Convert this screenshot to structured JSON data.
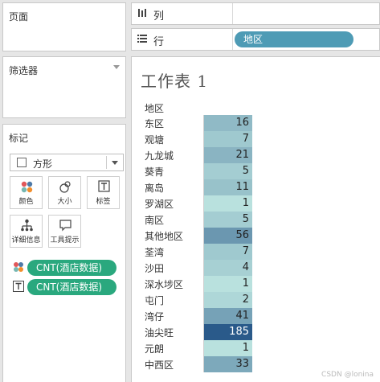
{
  "pages": {
    "title": "页面"
  },
  "filters": {
    "title": "筛选器"
  },
  "marks": {
    "title": "标记",
    "mark_type": "方形",
    "buttons": {
      "color": "颜色",
      "size": "大小",
      "label": "标签",
      "detail": "详细信息",
      "tooltip": "工具提示"
    },
    "pills": [
      {
        "text": "CNT(酒店数据)",
        "icon": "color-dots-icon"
      },
      {
        "text": "CNT(酒店数据)",
        "icon": "text-label-icon"
      }
    ],
    "pill_color": "#2aa87e"
  },
  "shelves": {
    "columns": {
      "label": "列",
      "icon": "columns-icon"
    },
    "rows": {
      "label": "行",
      "icon": "rows-icon",
      "pill": "地区"
    },
    "row_pill_color": "#4e9bb5"
  },
  "sheet": {
    "title": "工作表 1",
    "column_header": "地区",
    "rows": [
      {
        "name": "东区",
        "value": 16
      },
      {
        "name": "观塘",
        "value": 7
      },
      {
        "name": "九龙城",
        "value": 21
      },
      {
        "name": "葵青",
        "value": 5
      },
      {
        "name": "离岛",
        "value": 11
      },
      {
        "name": "罗湖区",
        "value": 1
      },
      {
        "name": "南区",
        "value": 5
      },
      {
        "name": "其他地区",
        "value": 56
      },
      {
        "name": "荃湾",
        "value": 7
      },
      {
        "name": "沙田",
        "value": 4
      },
      {
        "name": "深水埗区",
        "value": 1
      },
      {
        "name": "屯门",
        "value": 2
      },
      {
        "name": "湾仔",
        "value": 41
      },
      {
        "name": "油尖旺",
        "value": 185
      },
      {
        "name": "元朗",
        "value": 1
      },
      {
        "name": "中西区",
        "value": 33
      }
    ],
    "color_scale": {
      "low": "#b9e1de",
      "high": "#2a5a8a"
    }
  },
  "watermark": "CSDN @lonina"
}
